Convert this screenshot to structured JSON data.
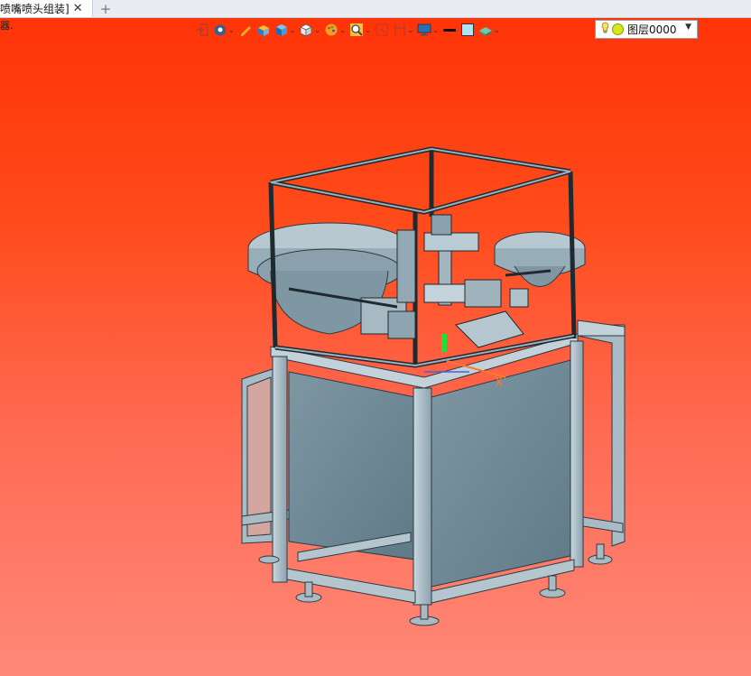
{
  "tab": {
    "title": "喷嘴喷头组装]",
    "close": "✕",
    "new": "+"
  },
  "viewport": {
    "label": "器."
  },
  "toolbar": {
    "items": [
      "exit-sketch",
      "view-orient",
      "line-tool",
      "shaded",
      "cube-blue",
      "cube-white",
      "display-style",
      "zoom",
      "box-select",
      "section",
      "monitor",
      "color-black",
      "color-lightblue",
      "material"
    ]
  },
  "layer": {
    "label": "图层0000"
  },
  "colors": {
    "bg_top": "#ff3407",
    "bg_bottom": "#ff8878",
    "metal": "#8fa7b4",
    "panel": "#6f8a97"
  }
}
